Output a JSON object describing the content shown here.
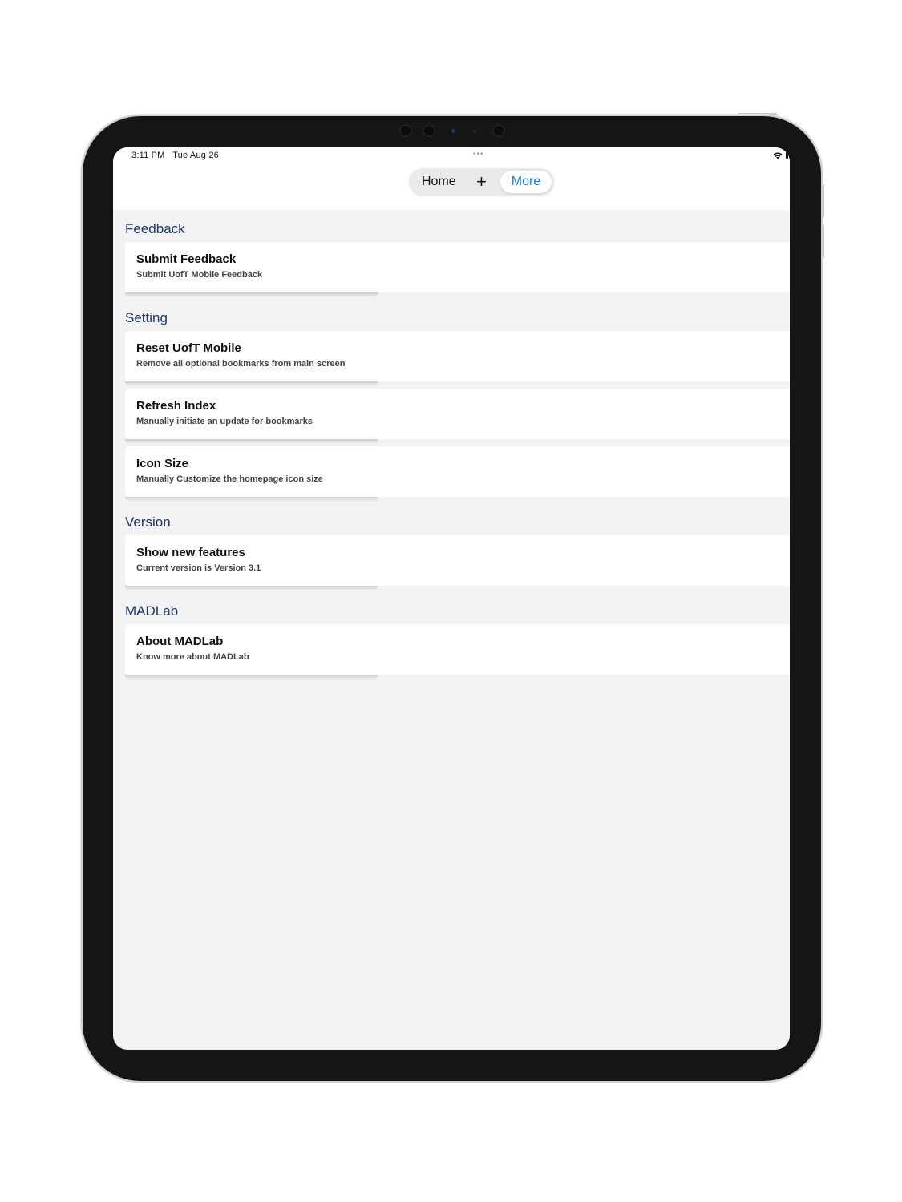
{
  "status_bar": {
    "time": "3:11 PM",
    "date": "Tue Aug 26",
    "dots": "•••"
  },
  "tabs": {
    "home": "Home",
    "add": "+",
    "more": "More",
    "active_color": "#1f7ad6"
  },
  "sections": [
    {
      "title": "Feedback",
      "items": [
        {
          "title": "Submit Feedback",
          "subtitle": "Submit UofT Mobile Feedback"
        }
      ]
    },
    {
      "title": "Setting",
      "items": [
        {
          "title": "Reset UofT Mobile",
          "subtitle": "Remove all optional bookmarks from main screen"
        },
        {
          "title": "Refresh Index",
          "subtitle": "Manually initiate an update for bookmarks"
        },
        {
          "title": "Icon Size",
          "subtitle": "Manually Customize the homepage icon size"
        }
      ]
    },
    {
      "title": "Version",
      "items": [
        {
          "title": "Show new features",
          "subtitle": "Current version is Version 3.1"
        }
      ]
    },
    {
      "title": "MADLab",
      "items": [
        {
          "title": "About MADLab",
          "subtitle": "Know more about MADLab"
        }
      ]
    }
  ],
  "colors": {
    "section_header": "#1e3765",
    "background": "#f2f2f2",
    "card": "#ffffff"
  }
}
